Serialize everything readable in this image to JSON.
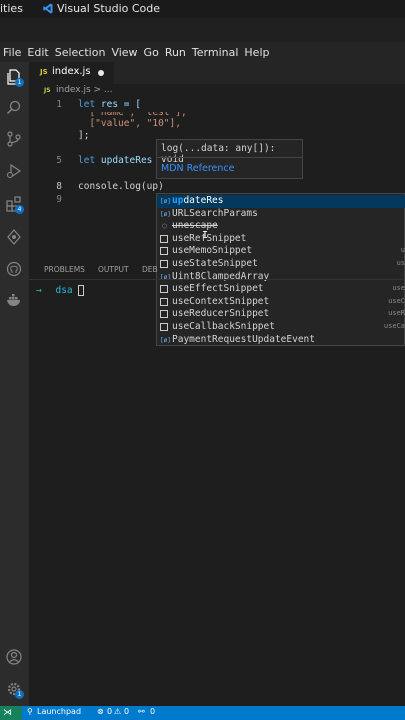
{
  "os_bar": {
    "activities": "ities",
    "app_name": "Visual Studio Code"
  },
  "menu": [
    "File",
    "Edit",
    "Selection",
    "View",
    "Go",
    "Run",
    "Terminal",
    "Help"
  ],
  "activity_badges": {
    "explorer": "1",
    "extensions": "4",
    "settings": "1"
  },
  "tab": {
    "icon_text": "JS",
    "filename": "index.js"
  },
  "breadcrumb": {
    "icon_text": "JS",
    "path": "index.js > ..."
  },
  "editor": {
    "lines": [
      {
        "num": "1",
        "kw": "let",
        "rest": "res = ["
      },
      {
        "num": "",
        "text": "  [\"name\", \"test\"],"
      },
      {
        "num": "",
        "text": "  [\"value\", \"10\"],"
      },
      {
        "num": "",
        "text": "];"
      },
      {
        "num": "5",
        "kw": "let",
        "rest": "updateRes"
      },
      {
        "num": "",
        "text": ""
      },
      {
        "num": "8",
        "text": "console.log(up)"
      },
      {
        "num": "9",
        "text": ""
      }
    ]
  },
  "hover": {
    "signature": "log(...data: any[]): void",
    "link": "MDN Reference"
  },
  "suggestions": [
    {
      "icon": "variable",
      "match": "up",
      "rest": "dateRes",
      "detail": ""
    },
    {
      "icon": "variable",
      "match": "",
      "rest": "URLSearchParams",
      "detail": ""
    },
    {
      "icon": "module",
      "match": "",
      "rest": "unescape",
      "detail": "",
      "deprecated": true
    },
    {
      "icon": "snippet",
      "match": "",
      "rest": "useRefSnippet",
      "detail": ""
    },
    {
      "icon": "snippet",
      "match": "",
      "rest": "useMemoSnippet",
      "detail": "u"
    },
    {
      "icon": "snippet",
      "match": "",
      "rest": "useStateSnippet",
      "detail": "us"
    },
    {
      "icon": "variable",
      "match": "",
      "rest": "Uint8ClampedArray",
      "detail": ""
    },
    {
      "icon": "snippet",
      "match": "",
      "rest": "useEffectSnippet",
      "detail": "use"
    },
    {
      "icon": "snippet",
      "match": "",
      "rest": "useContextSnippet",
      "detail": "useC"
    },
    {
      "icon": "snippet",
      "match": "",
      "rest": "useReducerSnippet",
      "detail": "useR"
    },
    {
      "icon": "snippet",
      "match": "",
      "rest": "useCallbackSnippet",
      "detail": "useCa"
    },
    {
      "icon": "variable",
      "match": "",
      "rest": "PaymentRequestUpdateEvent",
      "detail": ""
    }
  ],
  "panel": {
    "tabs": [
      "PROBLEMS",
      "OUTPUT",
      "DEB"
    ]
  },
  "terminal": {
    "prompt_arrow": "→",
    "dir": "dsa"
  },
  "status": {
    "remote": "⋊",
    "launchpad": "Launchpad",
    "errors": "0",
    "warnings": "0",
    "ports": "0"
  },
  "colors": {
    "accent": "#007acc",
    "match_highlight": "#18a3ff",
    "selection": "#04395e"
  }
}
